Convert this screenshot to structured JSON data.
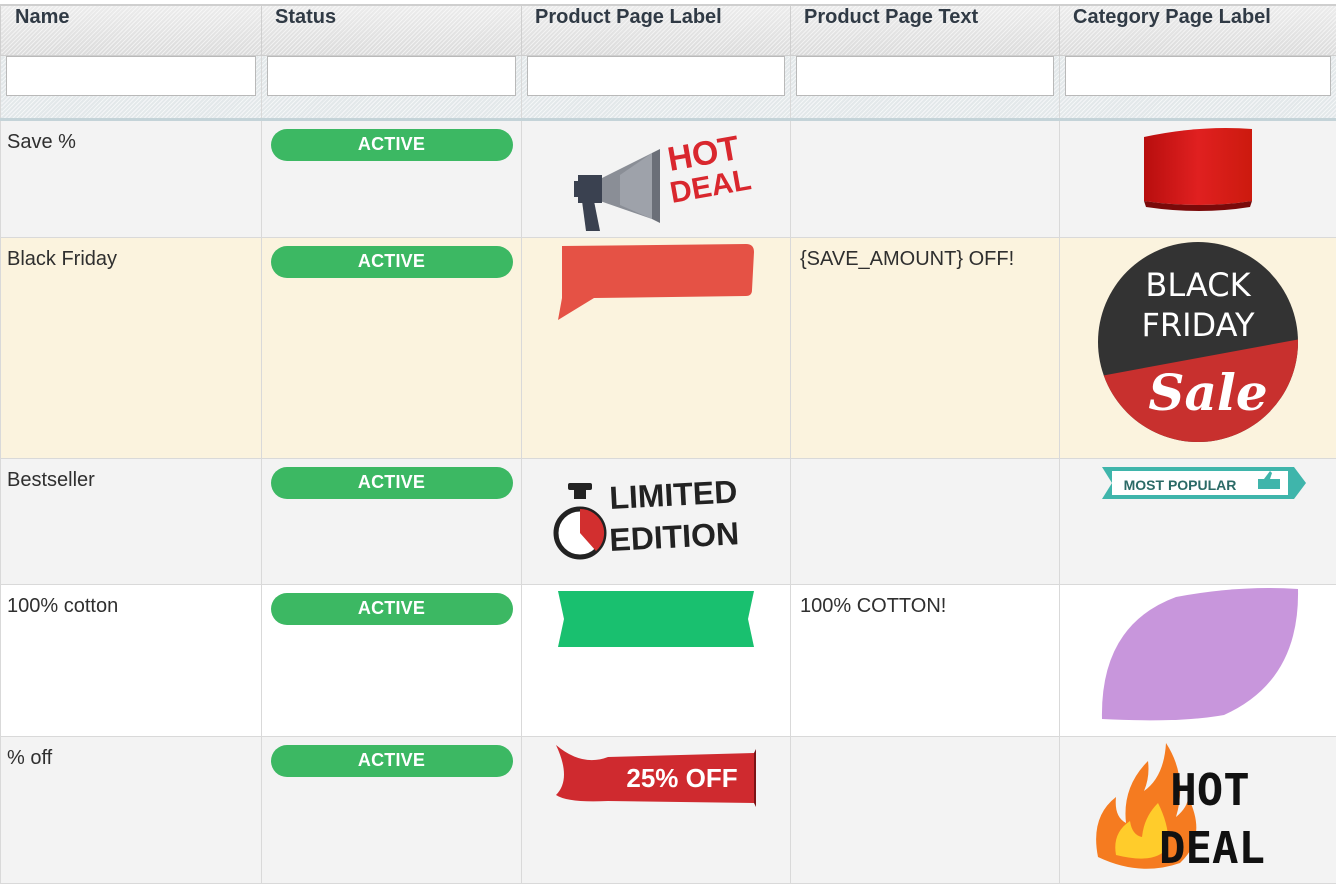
{
  "columns": {
    "name": "Name",
    "status": "Status",
    "product_page_label": "Product Page Label",
    "product_page_text": "Product Page Text",
    "category_page_label": "Category Page Label"
  },
  "filters": {
    "name": "",
    "status": "",
    "product_page_label": "",
    "product_page_text": "",
    "category_page_label": ""
  },
  "rows": [
    {
      "name": "Save %",
      "status": "ACTIVE",
      "product_page_text": "",
      "product_label": {
        "image": "megaphone-hot-deal",
        "text_1": "HOT",
        "text_2": "DEAL"
      },
      "category_label": {
        "image": "red-ribbon"
      }
    },
    {
      "name": "Black Friday",
      "status": "ACTIVE",
      "product_page_text": "{SAVE_AMOUNT} OFF!",
      "product_label": {
        "image": "red-speech-banner"
      },
      "category_label": {
        "image": "black-friday-sale-circle",
        "text_1": "BLACK",
        "text_2": "FRIDAY",
        "text_3": "Sale"
      }
    },
    {
      "name": "Bestseller",
      "status": "ACTIVE",
      "product_page_text": "",
      "product_label": {
        "image": "stopwatch-limited-edition",
        "text_1": "LIMITED",
        "text_2": "EDITION"
      },
      "category_label": {
        "image": "most-popular-thumb-ribbon",
        "text_1": "MOST POPULAR"
      }
    },
    {
      "name": "100% cotton",
      "status": "ACTIVE",
      "product_page_text": "100% COTTON!",
      "product_label": {
        "image": "green-ribbon"
      },
      "category_label": {
        "image": "purple-leaf"
      }
    },
    {
      "name": "% off",
      "status": "ACTIVE",
      "product_page_text": "",
      "product_label": {
        "image": "red-curl-ribbon",
        "text_1": "25% OFF"
      },
      "category_label": {
        "image": "flame-hot-deal",
        "text_1": "HOT",
        "text_2": "DEAL"
      }
    }
  ],
  "colors": {
    "status_active": "#3cb863",
    "row_highlight": "#fbf3de"
  }
}
